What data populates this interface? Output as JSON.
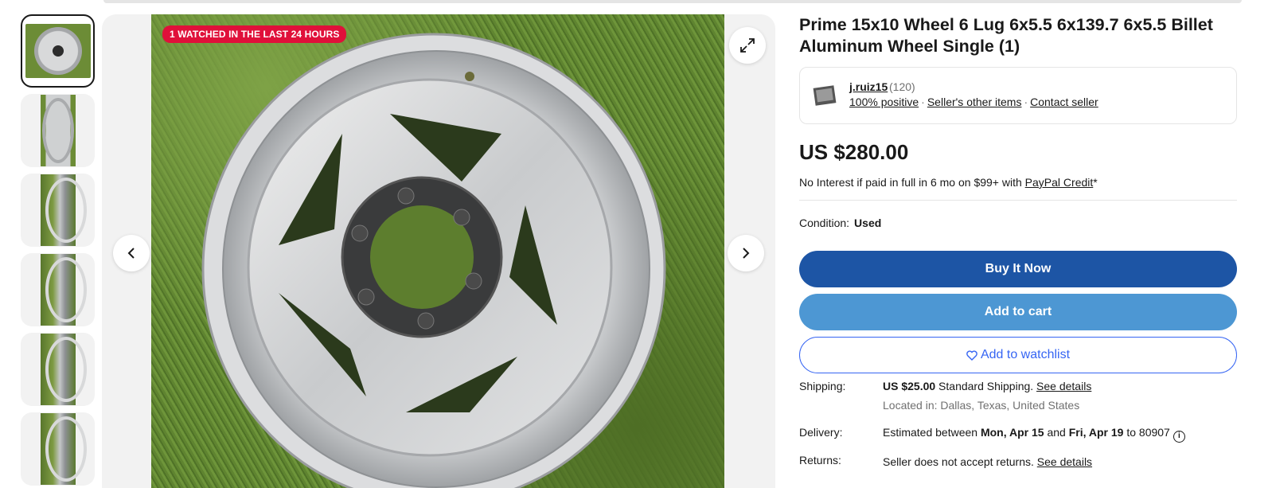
{
  "badge": "1 WATCHED IN THE LAST 24 HOURS",
  "listing": {
    "title": "Prime 15x10 Wheel 6 Lug 6x5.5 6x139.7 6x5.5 Billet Aluminum Wheel Single (1)",
    "price": "US $280.00"
  },
  "seller": {
    "name": "j.ruiz15",
    "count": "(120)",
    "positive": "100% positive",
    "other_items": "Seller's other items",
    "contact": "Contact seller",
    "separator": "·"
  },
  "credit": {
    "text": "No Interest if paid in full in 6 mo on $99+ with ",
    "link": "PayPal Credit",
    "suffix": "*"
  },
  "condition": {
    "label": "Condition:",
    "value": "Used"
  },
  "buttons": {
    "buy": "Buy It Now",
    "cart": "Add to cart",
    "watch": "Add to watchlist"
  },
  "shipping": {
    "label": "Shipping:",
    "price": "US $25.00",
    "method": " Standard Shipping. ",
    "details": "See details",
    "location": "Located in: Dallas, Texas, United States"
  },
  "delivery": {
    "label": "Delivery:",
    "prefix": "Estimated between ",
    "start": "Mon, Apr 15",
    "mid": " and ",
    "end": "Fri, Apr 19",
    "suffix": " to 80907"
  },
  "returns": {
    "label": "Returns:",
    "text": "Seller does not accept returns. ",
    "details": "See details"
  },
  "colors": {
    "buy": "#1d55a5",
    "cart": "#4d97d3",
    "watch": "#3665f3",
    "badge": "#e0103a"
  },
  "icons": {
    "prev": "chevron-left-icon",
    "next": "chevron-right-icon",
    "expand": "expand-icon",
    "heart": "heart-icon",
    "info": "info-icon"
  }
}
